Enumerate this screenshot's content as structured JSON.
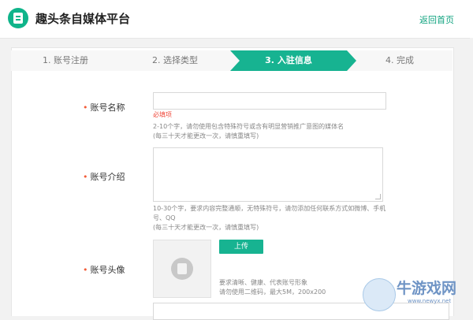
{
  "header": {
    "title": "趣头条自媒体平台",
    "home_link": "返回首页"
  },
  "steps": [
    {
      "label": "1. 账号注册",
      "active": false
    },
    {
      "label": "2. 选择类型",
      "active": false
    },
    {
      "label": "3. 入驻信息",
      "active": true
    },
    {
      "label": "4. 完成",
      "active": false
    }
  ],
  "form": {
    "account_name": {
      "label": "账号名称",
      "value": "",
      "error": "必填项",
      "hint_line1": "2-10个字，请勿使用包含特殊符号或含有明显营销推广意图的媒体名",
      "hint_line2": "(每三十天才能更改一次，请慎重填写)"
    },
    "account_intro": {
      "label": "账号介绍",
      "value": "",
      "hint_line1": "10-30个字，要求内容完整通顺，无特殊符号，请勿添加任何联系方式如微博、手机",
      "hint_line2": "号、QQ",
      "hint_line3": "(每三十天才能更改一次，请慎重填写)"
    },
    "account_avatar": {
      "label": "账号头像",
      "upload_label": "上传",
      "hint_line1": "要求清晰、健康、代表账号形象",
      "hint_line2": "请勿使用二维码，最大5M，200x200"
    }
  },
  "watermark": {
    "text": "牛游戏网",
    "url": "www.newyx.net"
  },
  "colors": {
    "accent": "#17b391",
    "error": "#f04b3e",
    "required_star": "#f35c38"
  },
  "icons": {
    "logo": "qutoutiao-logo-icon",
    "avatar_placeholder": "avatar-placeholder-icon"
  }
}
